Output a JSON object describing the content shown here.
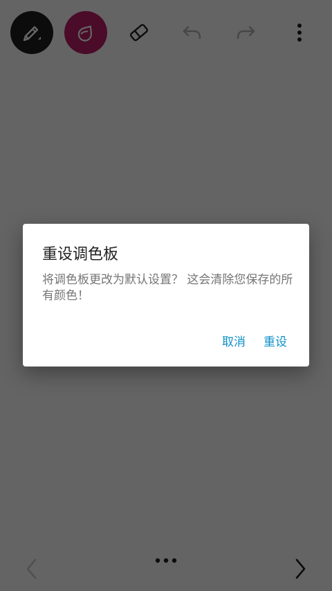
{
  "toolbar": {
    "items": [
      {
        "name": "pen-tool",
        "icon": "pen-icon"
      },
      {
        "name": "color-picker",
        "icon": "drop-icon",
        "color": "#b81e64"
      },
      {
        "name": "eraser-tool",
        "icon": "eraser-icon"
      },
      {
        "name": "undo",
        "icon": "undo-icon"
      },
      {
        "name": "redo",
        "icon": "redo-icon"
      },
      {
        "name": "more-options",
        "icon": "more-vertical-icon"
      }
    ]
  },
  "dialog": {
    "title": "重设调色板",
    "message": "将调色板更改为默认设置？ 这会清除您保存的所有颜色！",
    "cancel_label": "取消",
    "reset_label": "重设",
    "accent_color": "#0d8fc9"
  },
  "bottom_bar": {
    "prev_icon": "chevron-left-icon",
    "more_icon": "more-horizontal-icon",
    "next_icon": "chevron-right-icon"
  }
}
